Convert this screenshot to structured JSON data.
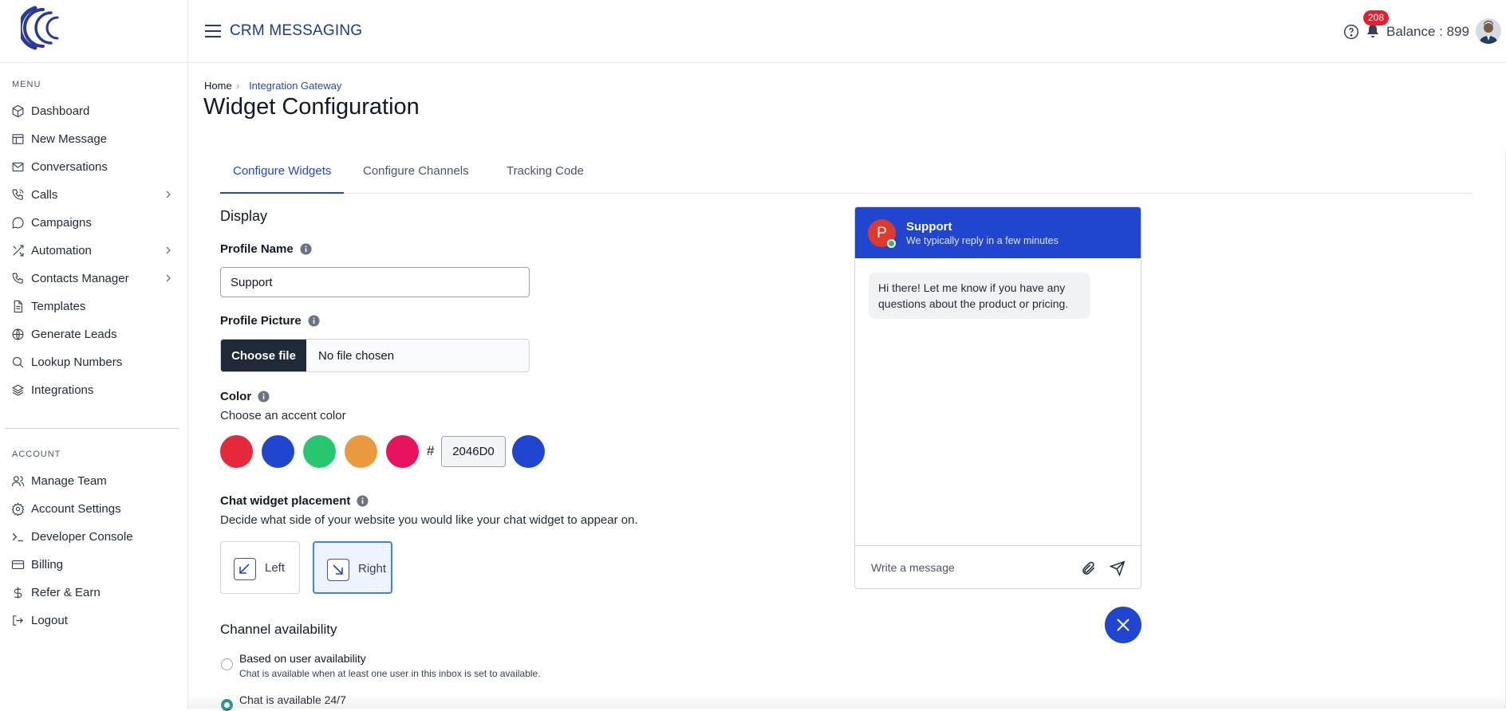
{
  "app": {
    "title": "CRM MESSAGING",
    "balance": "Balance : 899",
    "notification_count": "208"
  },
  "sidebar": {
    "menu_label": "MENU",
    "menu_items": [
      {
        "label": "Dashboard",
        "icon": "cube-icon"
      },
      {
        "label": "New Message",
        "icon": "table-icon"
      },
      {
        "label": "Conversations",
        "icon": "envelope-icon"
      },
      {
        "label": "Calls",
        "icon": "phone-icon",
        "has_submenu": true
      },
      {
        "label": "Campaigns",
        "icon": "chat-bubble-icon"
      },
      {
        "label": "Automation",
        "icon": "shuffle-icon",
        "has_submenu": true
      },
      {
        "label": "Contacts Manager",
        "icon": "phone-icon",
        "has_submenu": true
      },
      {
        "label": "Templates",
        "icon": "document-icon"
      },
      {
        "label": "Generate Leads",
        "icon": "globe-icon"
      },
      {
        "label": "Lookup Numbers",
        "icon": "search-icon"
      },
      {
        "label": "Integrations",
        "icon": "layers-icon"
      }
    ],
    "account_label": "ACCOUNT",
    "account_items": [
      {
        "label": "Manage Team",
        "icon": "users-icon"
      },
      {
        "label": "Account Settings",
        "icon": "gear-icon"
      },
      {
        "label": "Developer Console",
        "icon": "terminal-icon"
      },
      {
        "label": "Billing",
        "icon": "credit-card-icon"
      },
      {
        "label": "Refer & Earn",
        "icon": "dollar-icon"
      },
      {
        "label": "Logout",
        "icon": "logout-icon"
      }
    ]
  },
  "breadcrumb": {
    "home": "Home",
    "current": "Integration Gateway"
  },
  "page": {
    "title": "Widget Configuration"
  },
  "tabs": [
    {
      "label": "Configure Widgets",
      "active": true
    },
    {
      "label": "Configure Channels",
      "active": false
    },
    {
      "label": "Tracking Code",
      "active": false
    }
  ],
  "form": {
    "section_title": "Display",
    "profile_name_label": "Profile Name",
    "profile_name_value": "Support",
    "profile_picture_label": "Profile Picture",
    "choose_file_label": "Choose file",
    "file_status": "No file chosen",
    "color_label": "Color",
    "color_helper": "Choose an accent color",
    "swatches": [
      "#e5283a",
      "#2046d0",
      "#28c76f",
      "#ea9a3e",
      "#e8135e"
    ],
    "hex_prefix": "#",
    "hex_value": "2046D0",
    "selected_color": "#2046d0",
    "placement_label": "Chat widget placement",
    "placement_helper": "Decide what side of your website you would like your chat widget to appear on.",
    "placement_left": "Left",
    "placement_right": "Right",
    "placement_selected": "Right",
    "channel_title": "Channel availability",
    "channel_options": [
      {
        "title": "Based on user availability",
        "desc": "Chat is available when at least one user in this inbox is set to available.",
        "selected": false
      },
      {
        "title": "Chat is available 24/7",
        "desc": "",
        "selected": true
      }
    ]
  },
  "chat_preview": {
    "avatar_initial": "P",
    "name": "Support",
    "subtitle": "We typically reply in a few minutes",
    "message": "Hi there! Let me know if you have any questions about the product or pricing.",
    "input_placeholder": "Write a message",
    "accent_color": "#2046d0"
  }
}
